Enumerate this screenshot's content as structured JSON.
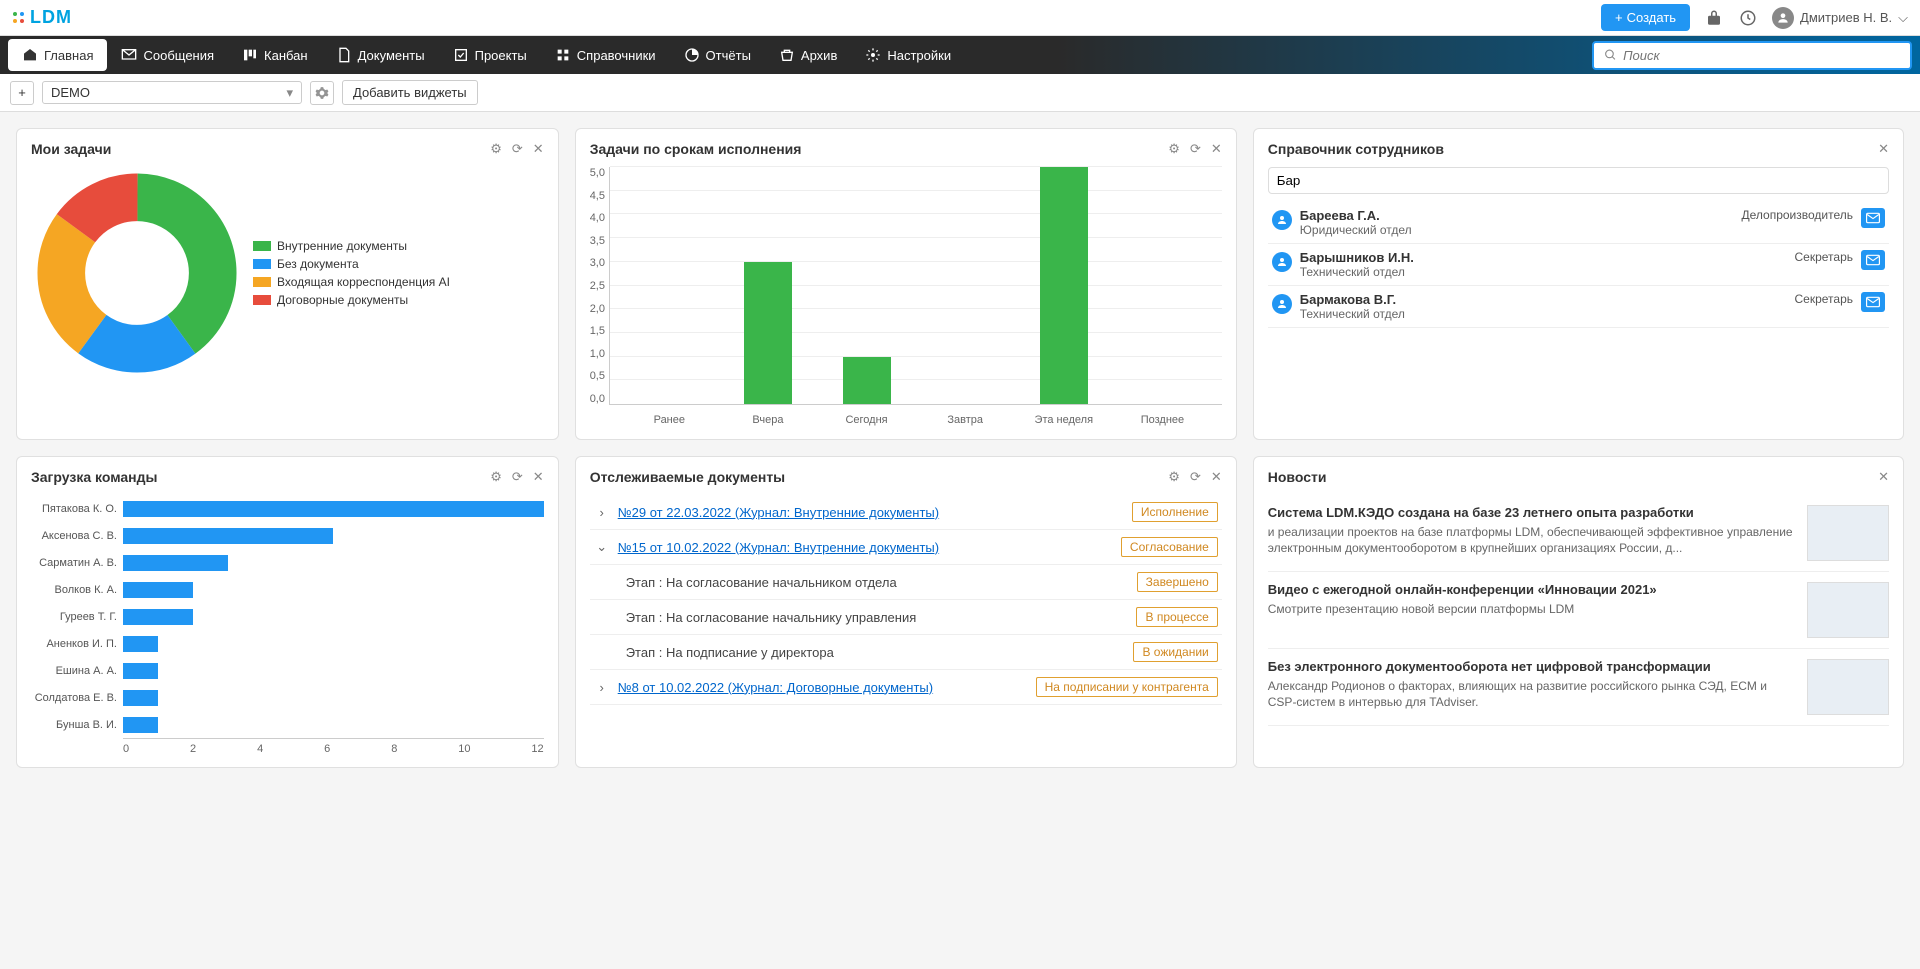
{
  "brand": "LDM",
  "topbar": {
    "create": "Создать",
    "user": "Дмитриев Н. В."
  },
  "nav": {
    "items": [
      {
        "label": "Главная",
        "active": true
      },
      {
        "label": "Сообщения"
      },
      {
        "label": "Канбан"
      },
      {
        "label": "Документы"
      },
      {
        "label": "Проекты"
      },
      {
        "label": "Справочники"
      },
      {
        "label": "Отчёты"
      },
      {
        "label": "Архив"
      },
      {
        "label": "Настройки"
      }
    ],
    "search_placeholder": "Поиск"
  },
  "subbar": {
    "selected_dashboard": "DEMO",
    "add_widgets": "Добавить виджеты"
  },
  "widgets": {
    "tasks": {
      "title": "Мои задачи"
    },
    "deadlines": {
      "title": "Задачи по срокам исполнения"
    },
    "employees": {
      "title": "Справочник сотрудников",
      "query": "Бар",
      "rows": [
        {
          "name": "Бареева Г.А.",
          "dept": "Юридический отдел",
          "role": "Делопроизводитель"
        },
        {
          "name": "Барышников И.Н.",
          "dept": "Технический отдел",
          "role": "Секретарь"
        },
        {
          "name": "Бармакова В.Г.",
          "dept": "Технический отдел",
          "role": "Секретарь"
        }
      ]
    },
    "teamload": {
      "title": "Загрузка команды"
    },
    "tracked": {
      "title": "Отслеживаемые документы",
      "rows": [
        {
          "type": "doc",
          "expand": "closed",
          "link": "№29 от 22.03.2022 (Журнал: Внутренние документы)",
          "status": "Исполнение"
        },
        {
          "type": "doc",
          "expand": "open",
          "link": "№15 от 10.02.2022 (Журнал: Внутренние документы)",
          "status": "Согласование"
        },
        {
          "type": "stage",
          "text": "Этап : На согласование начальником отдела",
          "status": "Завершено"
        },
        {
          "type": "stage",
          "text": "Этап : На согласование начальнику управления",
          "status": "В процессе"
        },
        {
          "type": "stage",
          "text": "Этап : На подписание у директора",
          "status": "В ожидании"
        },
        {
          "type": "doc",
          "expand": "closed",
          "link": "№8 от 10.02.2022 (Журнал: Договорные документы)",
          "status": "На подписании у контрагента"
        }
      ]
    },
    "news": {
      "title": "Новости",
      "items": [
        {
          "title": "Система LDM.КЭДО создана на базе 23 летнего опыта разработки",
          "desc": "и реализации проектов на базе платформы LDM, обеспечивающей эффективное управление электронным документооборотом в крупнейших организациях России, д..."
        },
        {
          "title": "Видео с ежегодной онлайн-конференции «Инновации 2021»",
          "desc": "Смотрите презентацию новой версии платформы LDM"
        },
        {
          "title": "Без электронного документооборота нет цифровой трансформации",
          "desc": "Александр Родионов о факторах, влияющих на развитие российского рынка СЭД, ECM и CSP-систем в интервью для TAdviser."
        }
      ]
    }
  },
  "chart_data": [
    {
      "id": "tasks_donut",
      "type": "pie",
      "title": "Мои задачи",
      "series": [
        {
          "name": "Внутренние документы",
          "value": 40,
          "color": "#3ab54a"
        },
        {
          "name": "Без документа",
          "value": 20,
          "color": "#2196f3"
        },
        {
          "name": "Входящая корреспонденция AI",
          "value": 25,
          "color": "#f5a623"
        },
        {
          "name": "Договорные документы",
          "value": 15,
          "color": "#e74c3c"
        }
      ]
    },
    {
      "id": "deadlines_bar",
      "type": "bar",
      "title": "Задачи по срокам исполнения",
      "categories": [
        "Ранее",
        "Вчера",
        "Сегодня",
        "Завтра",
        "Эта неделя",
        "Позднее"
      ],
      "values": [
        0,
        3,
        1,
        0,
        5,
        0
      ],
      "ylim": [
        0,
        5
      ],
      "ystep": 0.5
    },
    {
      "id": "teamload_hbar",
      "type": "bar",
      "orientation": "horizontal",
      "title": "Загрузка команды",
      "categories": [
        "Пятакова К. О.",
        "Аксенова С. В.",
        "Сарматин А. В.",
        "Волков К. А.",
        "Гуреев Т. Г.",
        "Аненков И. П.",
        "Ешина А. А.",
        "Солдатова Е. В.",
        "Бунша В. И."
      ],
      "values": [
        12,
        6,
        3,
        2,
        2,
        1,
        1,
        1,
        1
      ],
      "xlim": [
        0,
        12
      ],
      "xticks": [
        0,
        2,
        4,
        6,
        8,
        10,
        12
      ]
    }
  ]
}
